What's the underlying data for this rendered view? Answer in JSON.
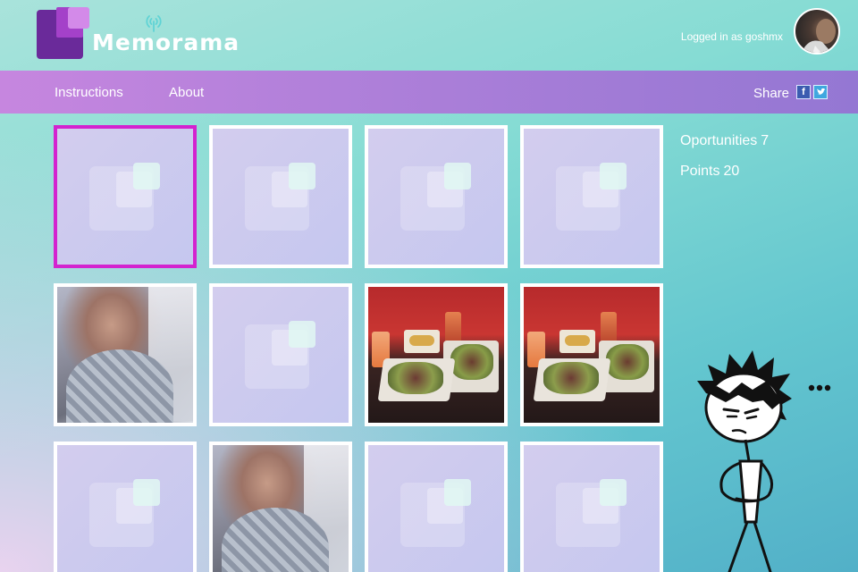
{
  "app": {
    "logo_text": "Memorama",
    "login_text": "Logged in as goshmx"
  },
  "nav": {
    "items": [
      {
        "label": "Instructions"
      },
      {
        "label": "About"
      }
    ],
    "share_label": "Share"
  },
  "stats": {
    "opportunities_label": "Oportunities",
    "opportunities_value": "7",
    "points_label": "Points",
    "points_value": "20"
  },
  "board": {
    "cards": [
      {
        "state": "hidden",
        "selected": true
      },
      {
        "state": "hidden"
      },
      {
        "state": "hidden"
      },
      {
        "state": "hidden"
      },
      {
        "state": "revealed",
        "image": "selfie-photo"
      },
      {
        "state": "hidden"
      },
      {
        "state": "revealed",
        "image": "food-photo"
      },
      {
        "state": "revealed",
        "image": "food-photo"
      },
      {
        "state": "hidden"
      },
      {
        "state": "revealed",
        "image": "selfie-photo"
      },
      {
        "state": "hidden"
      },
      {
        "state": "hidden"
      }
    ]
  },
  "colors": {
    "selected_border": "#d323cf",
    "nav_gradient_start": "#c686df",
    "nav_gradient_end": "#9477d3",
    "logo_purple": "#6a2a9a"
  },
  "icons": [
    "signal-icon",
    "facebook-icon",
    "twitter-icon",
    "thinking-stickman-icon"
  ]
}
